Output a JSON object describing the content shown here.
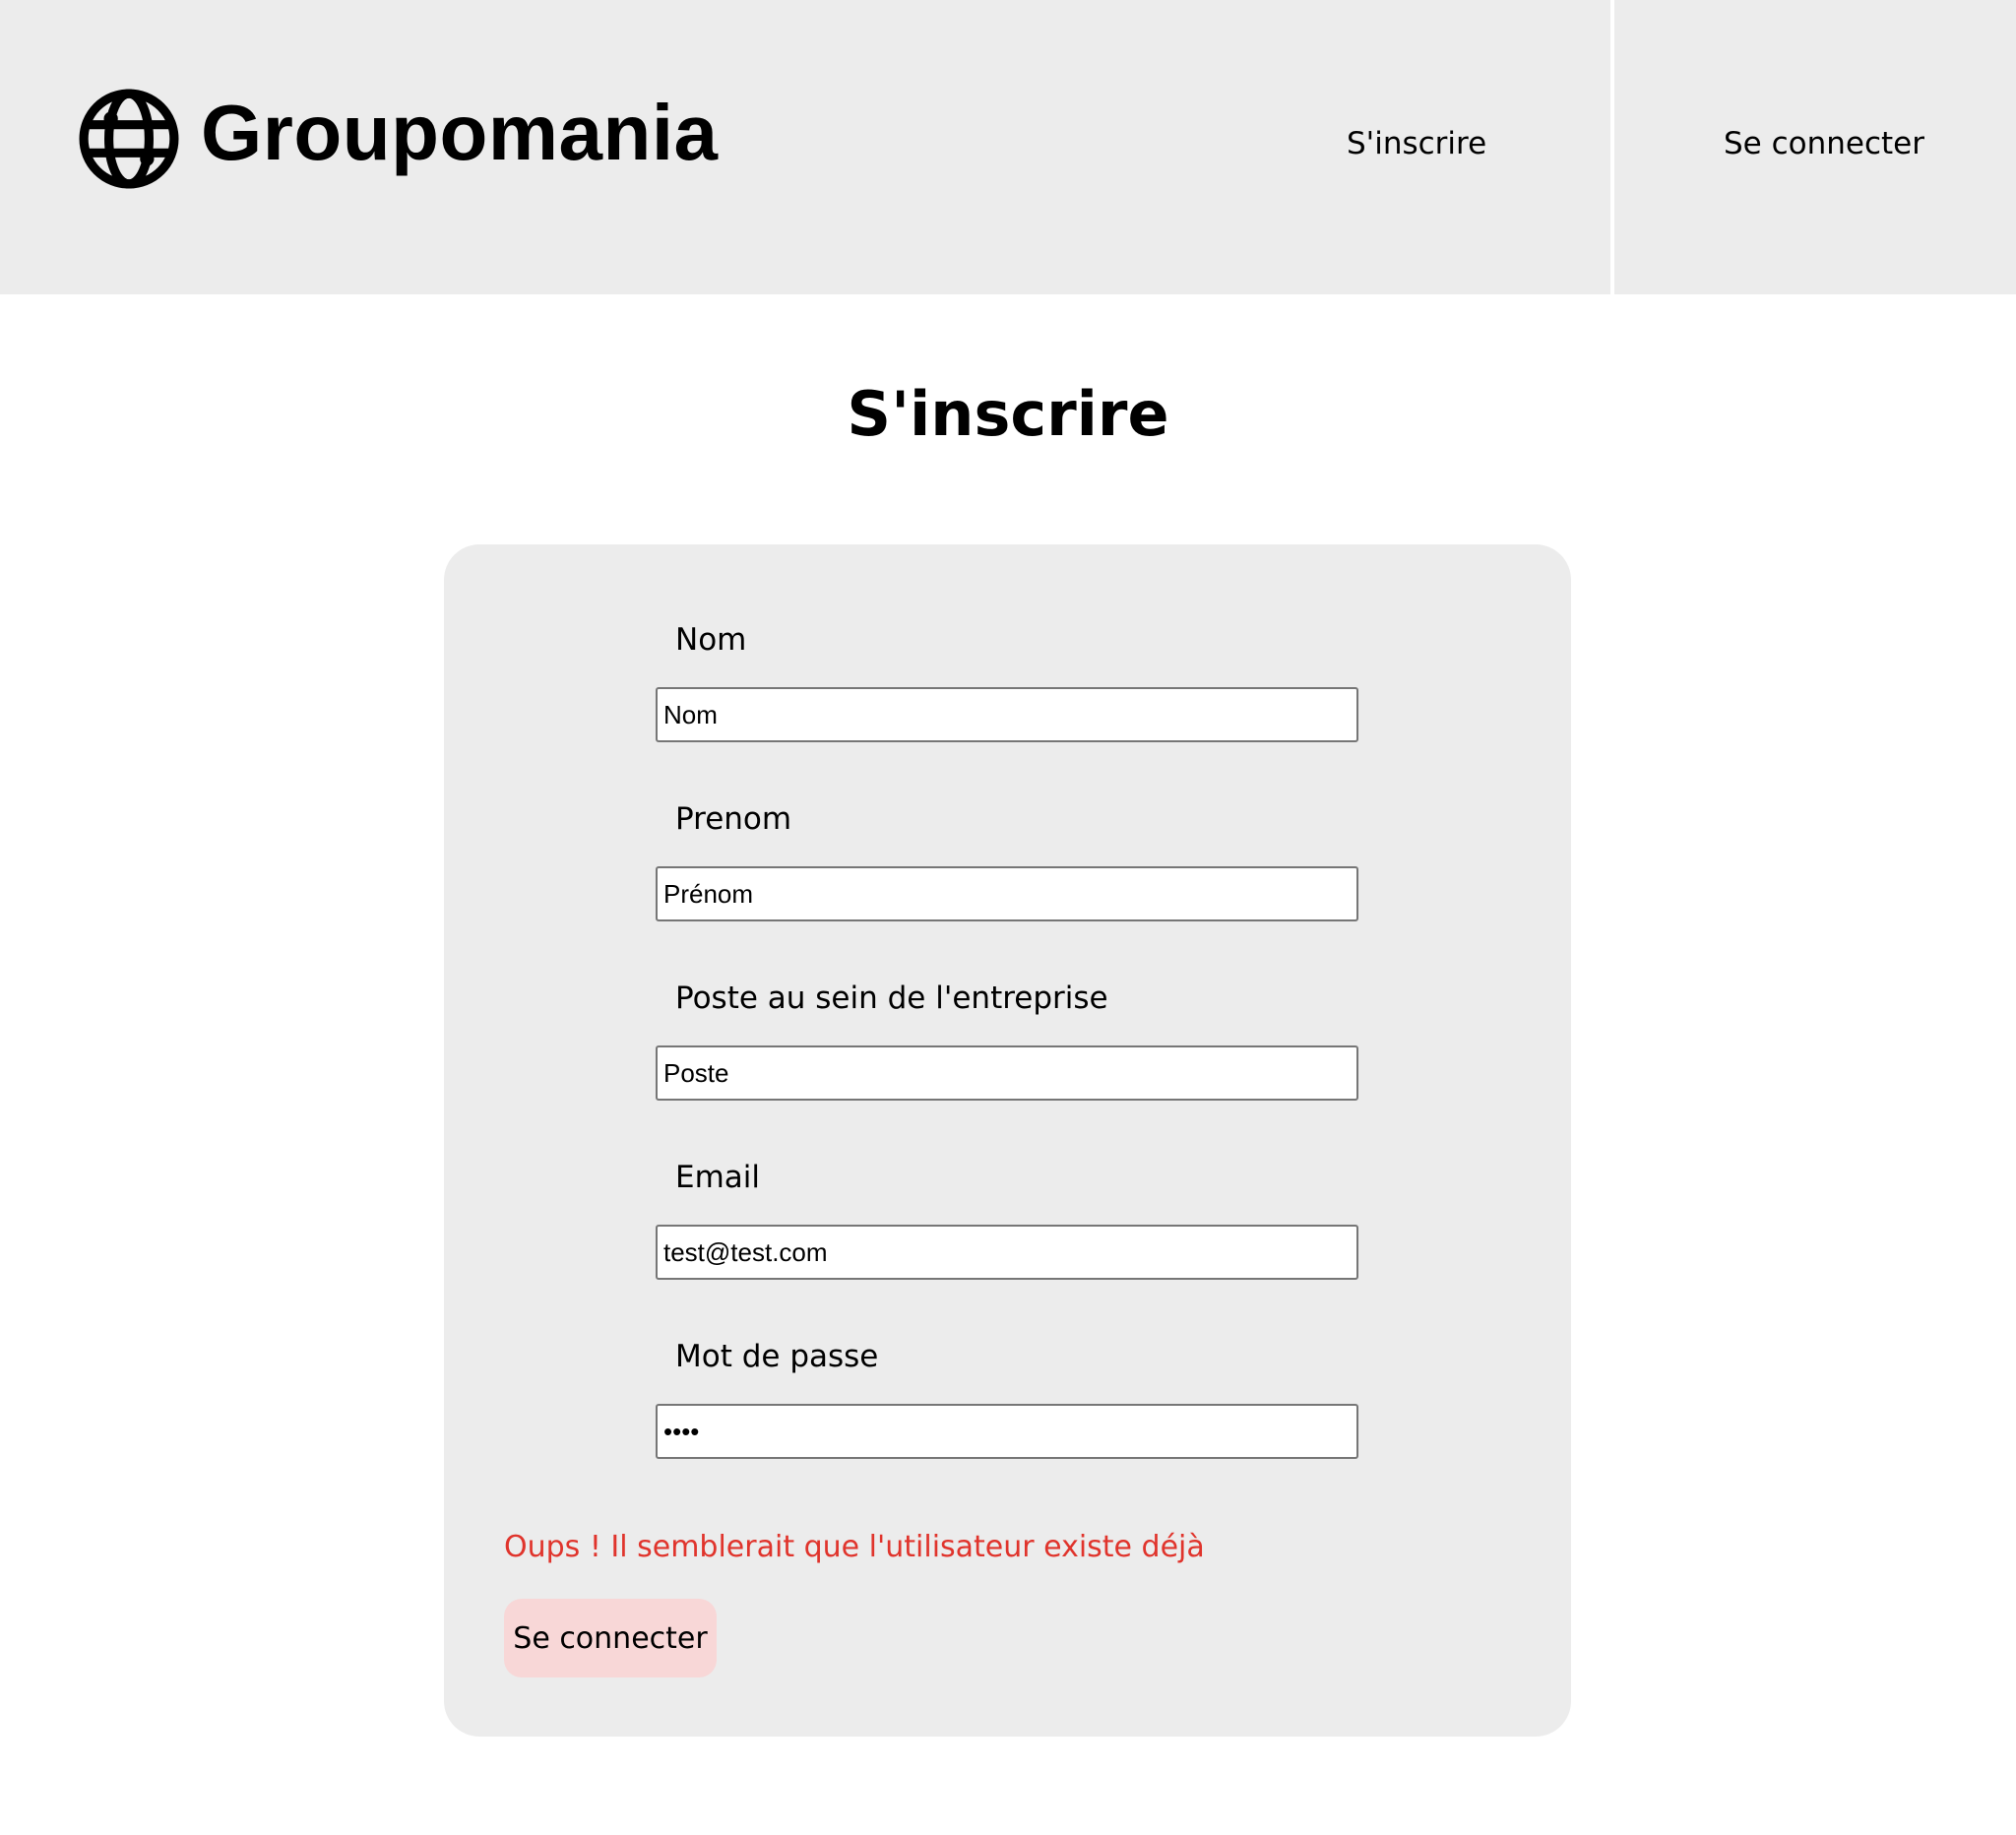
{
  "header": {
    "brand_name": "Groupomania",
    "logo_icon": "globe-icon",
    "nav": {
      "signup_label": "S'inscrire",
      "login_label": "Se connecter"
    }
  },
  "page": {
    "title": "S'inscrire"
  },
  "form": {
    "fields": [
      {
        "label": "Nom",
        "value": "Nom",
        "type": "text"
      },
      {
        "label": "Prenom",
        "value": "Prénom",
        "type": "text"
      },
      {
        "label": "Poste au sein de l'entreprise",
        "value": "Poste",
        "type": "text"
      },
      {
        "label": "Email",
        "value": "test@test.com",
        "type": "email"
      },
      {
        "label": "Mot de passe",
        "value": "test",
        "type": "password"
      }
    ],
    "error_message": "Oups ! Il semblerait que l'utilisateur existe déjà",
    "submit_label": "Se connecter"
  },
  "colors": {
    "header_bg": "#ececec",
    "card_bg": "#ececec",
    "error_text": "#e0342c",
    "button_bg": "#f8d7d7"
  }
}
